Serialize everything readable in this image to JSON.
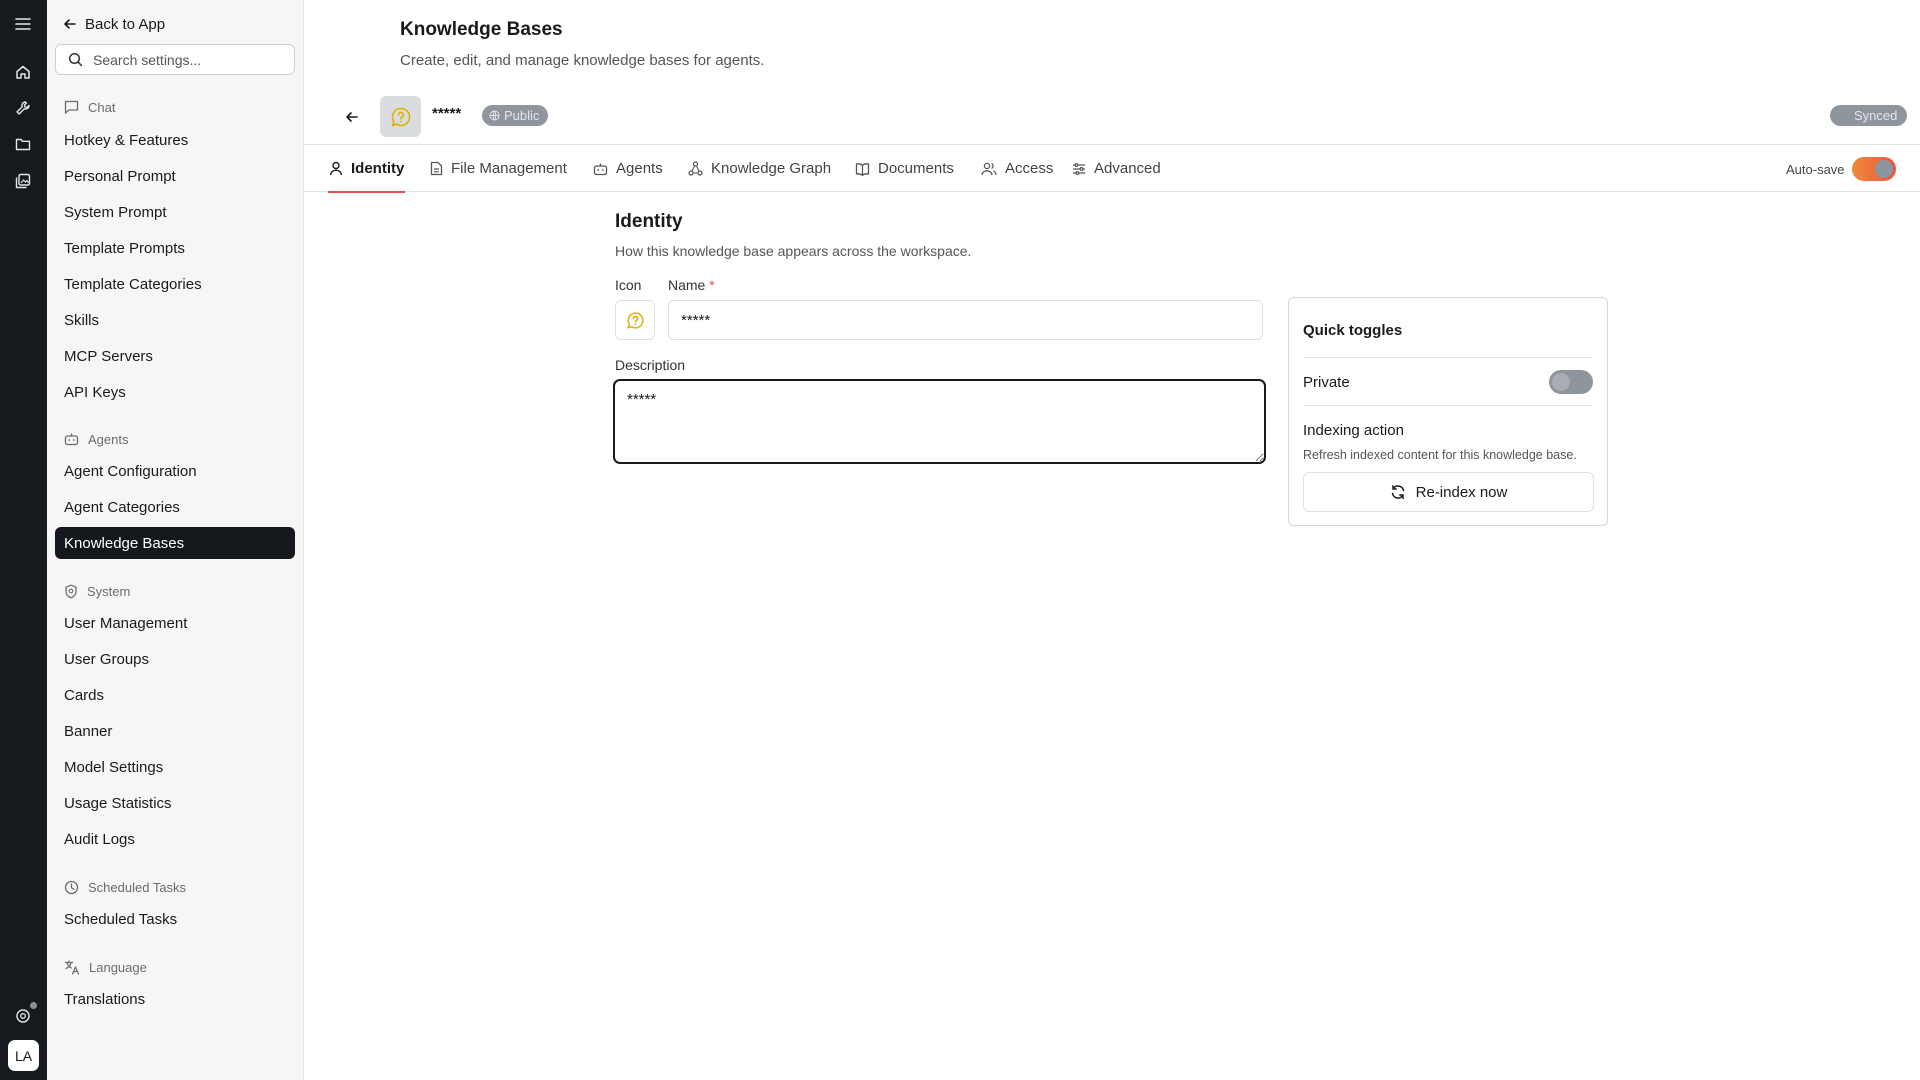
{
  "sidebar": {
    "back_label": "Back to App",
    "search_placeholder": "Search settings...",
    "sections": {
      "chat": "Chat",
      "agents": "Agents",
      "system": "System",
      "scheduled": "Scheduled Tasks",
      "language": "Language"
    },
    "items": {
      "hotkey": "Hotkey & Features",
      "personal_prompt": "Personal Prompt",
      "system_prompt": "System Prompt",
      "template_prompts": "Template Prompts",
      "template_categories": "Template Categories",
      "skills": "Skills",
      "mcp_servers": "MCP Servers",
      "api_keys": "API Keys",
      "agent_configuration": "Agent Configuration",
      "agent_categories": "Agent Categories",
      "knowledge_bases": "Knowledge Bases",
      "user_management": "User Management",
      "user_groups": "User Groups",
      "cards": "Cards",
      "banner": "Banner",
      "model_settings": "Model Settings",
      "usage_statistics": "Usage Statistics",
      "audit_logs": "Audit Logs",
      "scheduled_tasks": "Scheduled Tasks",
      "translations": "Translations"
    },
    "active_item": "knowledge_bases"
  },
  "rail": {
    "avatar_initials": "LA",
    "icons": [
      "menu-icon",
      "home-icon",
      "wrench-icon",
      "folder-icon",
      "gallery-icon",
      "help-icon"
    ]
  },
  "header": {
    "title": "Knowledge Bases",
    "subtitle": "Create, edit, and manage knowledge bases for agents."
  },
  "kb": {
    "name": "*****",
    "visibility": "Public",
    "sync_status": "Synced"
  },
  "tabs": {
    "identity": "Identity",
    "file_management": "File Management",
    "agents": "Agents",
    "knowledge_graph": "Knowledge Graph",
    "documents": "Documents",
    "access": "Access",
    "advanced": "Advanced",
    "active": "identity"
  },
  "autosave": {
    "label": "Auto-save",
    "on": true
  },
  "identity": {
    "title": "Identity",
    "description": "How this knowledge base appears across the workspace.",
    "icon_label": "Icon",
    "name_label": "Name",
    "required_mark": "*",
    "name_value": "*****",
    "description_label": "Description",
    "description_value": "*****"
  },
  "quick_toggles": {
    "title": "Quick toggles",
    "private_label": "Private",
    "private_on": false,
    "indexing_title": "Indexing action",
    "indexing_desc": "Refresh indexed content for this knowledge base.",
    "reindex_label": "Re-index now"
  },
  "colors": {
    "accent": "#e8563f",
    "active_nav_bg": "#14171b",
    "rail_bg": "#161a1f",
    "badge_bg": "#8f959c",
    "kb_icon": "#e0b000"
  }
}
